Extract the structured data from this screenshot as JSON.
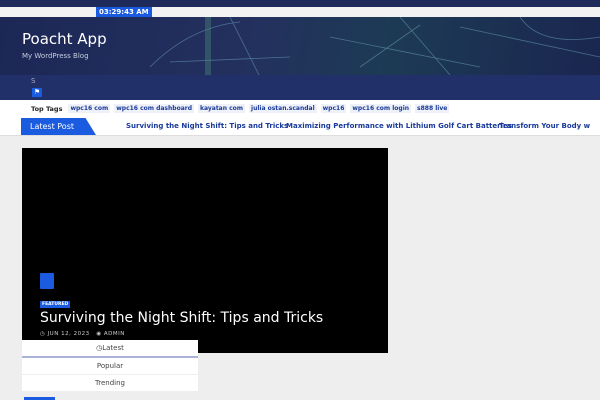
{
  "clock": "03:29:43 AM",
  "site": {
    "title": "Poacht App",
    "description": "My WordPress Blog"
  },
  "nav": {
    "s_icon": "S"
  },
  "top_tags": {
    "label": "Top Tags",
    "items": [
      "wpc16 com",
      "wpc16 com dashboard",
      "kayatan com",
      "julia ostan.scandal",
      "wpc16",
      "wpc16 com login",
      "s888 live"
    ]
  },
  "ticker": {
    "label": "Latest Post",
    "items": [
      "Surviving the Night Shift: Tips and Tricks",
      "Maximizing Performance with Lithium Golf Cart Batteries",
      "Transform Your Body w"
    ]
  },
  "featured": {
    "badge": "FEATURED",
    "title": "Surviving the Night Shift: Tips and Tricks",
    "date": "JUN 12, 2023",
    "author": "ADMIN"
  },
  "tabs": [
    "Latest",
    "Popular",
    "Trending"
  ],
  "colors": {
    "accent": "#1a5be0",
    "navy": "#22306a"
  }
}
